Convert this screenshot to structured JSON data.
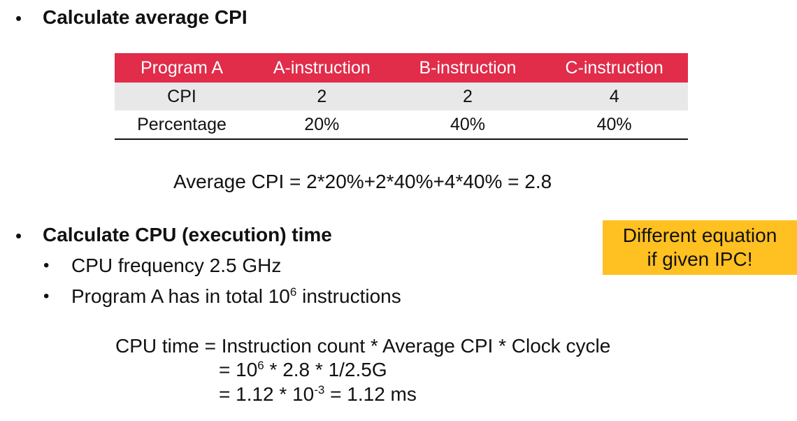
{
  "section1": {
    "bullet": "•",
    "heading": "Calculate average CPI"
  },
  "table": {
    "headers": [
      "Program A",
      "A-instruction",
      "B-instruction",
      "C-instruction"
    ],
    "rows": [
      [
        "CPI",
        "2",
        "2",
        "4"
      ],
      [
        "Percentage",
        "20%",
        "40%",
        "40%"
      ]
    ]
  },
  "avg_formula": "Average CPI = 2*20%+2*40%+4*40% = 2.8",
  "section2": {
    "bullet": "•",
    "heading": "Calculate CPU (execution) time",
    "items": [
      {
        "bullet": "•",
        "text": "CPU frequency 2.5 GHz"
      },
      {
        "bullet": "•",
        "text_before": "Program A has in total 10",
        "sup": "6",
        "text_after": " instructions"
      }
    ]
  },
  "callout": {
    "line1": "Different equation",
    "line2": "if given IPC!",
    "color": "#ffc021"
  },
  "cpu_formula": {
    "line1": "CPU time = Instruction count * Average CPI * Clock cycle",
    "line2_before": "= 10",
    "line2_sup": "6",
    "line2_after": " * 2.8 * 1/2.5G",
    "line3_before": "= 1.12 * 10",
    "line3_sup": "-3",
    "line3_after": " = 1.12 ms"
  },
  "colors": {
    "table_header": "#e12c4a",
    "table_row_alt": "#e8e8e8"
  }
}
